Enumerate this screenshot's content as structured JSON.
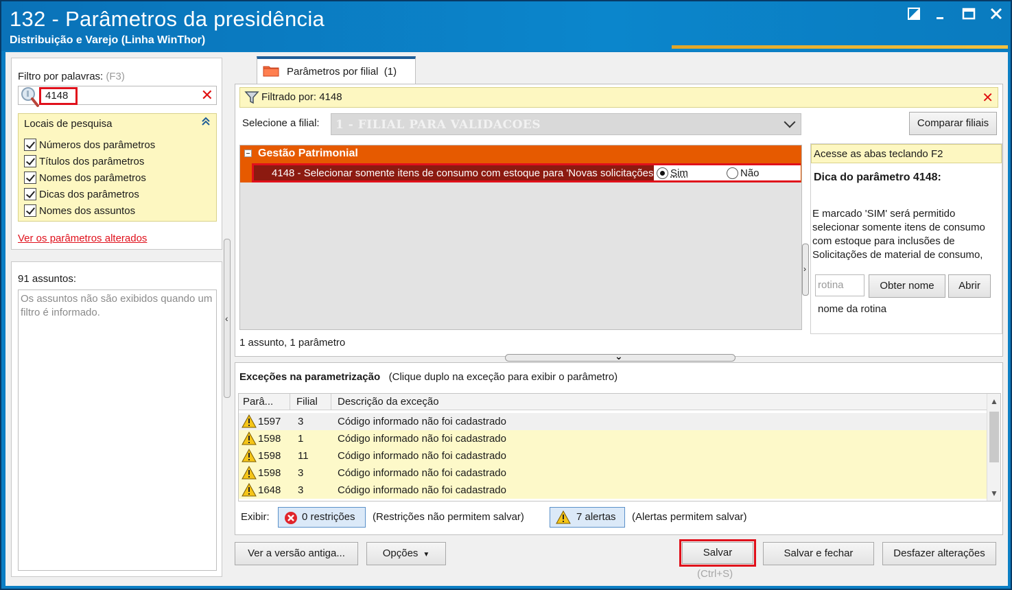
{
  "window": {
    "title": "132 - Parâmetros da presidência",
    "subtitle": "Distribuição e Varejo (Linha WinThor)"
  },
  "filter": {
    "label": "Filtro por palavras:",
    "shortcut": "(F3)",
    "value": "4148",
    "locais_title": "Locais de pesquisa",
    "options": [
      "Números dos parâmetros",
      "Títulos dos parâmetros",
      "Nomes dos parâmetros",
      "Dicas dos parâmetros",
      "Nomes dos assuntos"
    ],
    "altered_link": "Ver os parâmetros alterados"
  },
  "assuntos": {
    "count_label": "91 assuntos:",
    "message": "Os assuntos não são exibidos quando um filtro é informado."
  },
  "tab": {
    "label": "Parâmetros por filial",
    "count": "(1)"
  },
  "filtered": {
    "text": "Filtrado por: 4148"
  },
  "filial": {
    "label": "Selecione a filial:",
    "selected": "1 - FILIAL PARA VALIDACOES",
    "compare_button": "Comparar filiais"
  },
  "tree": {
    "group": "Gestão Patrimonial",
    "param_text": "4148 - Selecionar somente itens de consumo com estoque para 'Novas solicitações'",
    "option_yes": "Sim",
    "option_no": "Não",
    "summary": "1 assunto, 1 parâmetro"
  },
  "tip": {
    "hint": "Acesse as abas teclando F2",
    "title": "Dica do parâmetro 4148:",
    "text": "E marcado 'SIM' será permitido selecionar somente itens de consumo com estoque para inclusões de Solicitações de material de consumo,",
    "rotina_placeholder": "rotina",
    "obter_button": "Obter nome",
    "abrir_button": "Abrir",
    "rotina_label": "nome da rotina"
  },
  "exceptions": {
    "title": "Exceções na parametrização",
    "subtitle": "(Clique duplo na exceção para exibir o parâmetro)",
    "columns": [
      "Parâ...",
      "Filial",
      "Descrição da exceção"
    ],
    "rows": [
      {
        "param": "1597",
        "filial": "3",
        "desc": "Código informado não foi cadastrado"
      },
      {
        "param": "1598",
        "filial": "1",
        "desc": "Código informado não foi cadastrado"
      },
      {
        "param": "1598",
        "filial": "11",
        "desc": "Código informado não foi cadastrado"
      },
      {
        "param": "1598",
        "filial": "3",
        "desc": "Código informado não foi cadastrado"
      },
      {
        "param": "1648",
        "filial": "3",
        "desc": "Código informado não foi cadastrado"
      }
    ],
    "exibir_label": "Exibir:",
    "restricoes_button": "0 restrições",
    "restricoes_note": "(Restrições não permitem salvar)",
    "alertas_button": "7 alertas",
    "alertas_note": "(Alertas permitem salvar)"
  },
  "footer": {
    "old_version_button": "Ver a versão antiga...",
    "options_button": "Opções",
    "save_button": "Salvar",
    "save_shortcut": "(Ctrl+S)",
    "save_close_button": "Salvar e fechar",
    "undo_button": "Desfazer alterações"
  }
}
